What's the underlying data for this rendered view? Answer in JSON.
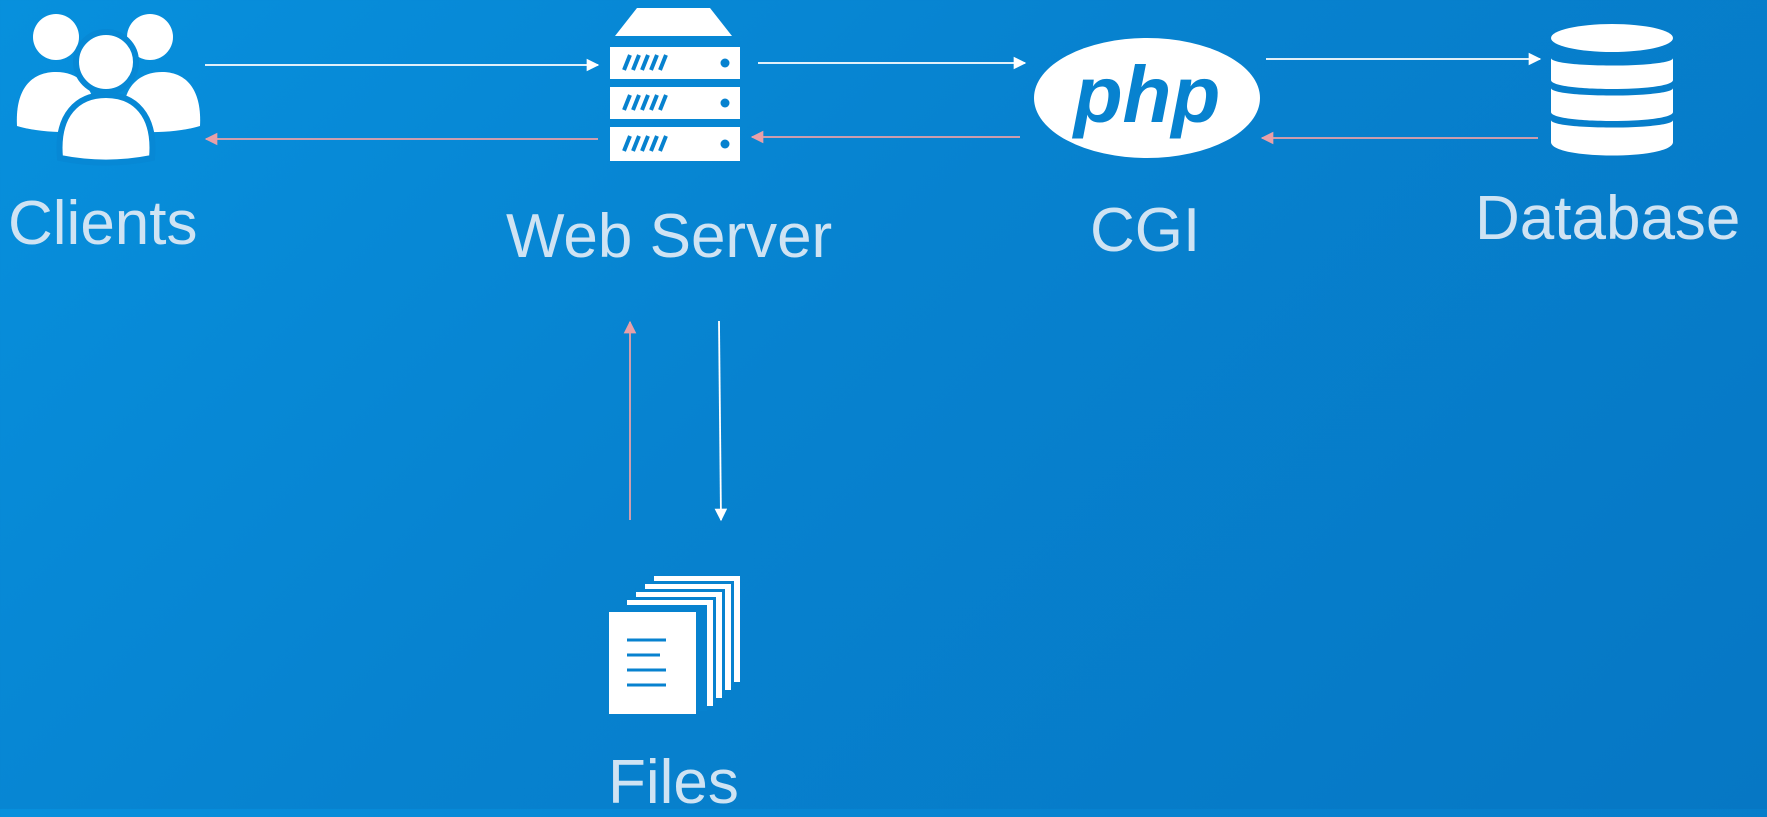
{
  "diagram": {
    "nodes": {
      "clients": {
        "label": "Clients",
        "icon": "users-group-icon"
      },
      "web_server": {
        "label": "Web Server",
        "icon": "server-rack-icon"
      },
      "cgi": {
        "label": "CGI",
        "icon": "php-logo-icon",
        "logo_text": "php"
      },
      "database": {
        "label": "Database",
        "icon": "database-icon"
      },
      "files": {
        "label": "Files",
        "icon": "documents-stack-icon"
      }
    },
    "edges": [
      {
        "from": "clients",
        "to": "web_server",
        "kind": "request"
      },
      {
        "from": "web_server",
        "to": "clients",
        "kind": "response"
      },
      {
        "from": "web_server",
        "to": "cgi",
        "kind": "request"
      },
      {
        "from": "cgi",
        "to": "web_server",
        "kind": "response"
      },
      {
        "from": "cgi",
        "to": "database",
        "kind": "request"
      },
      {
        "from": "database",
        "to": "cgi",
        "kind": "response"
      },
      {
        "from": "web_server",
        "to": "files",
        "kind": "request"
      },
      {
        "from": "files",
        "to": "web_server",
        "kind": "response"
      }
    ],
    "colors": {
      "background": "#0782cf",
      "icon": "#ffffff",
      "label": "#cfe3f3",
      "request_arrow": "#ffffff",
      "response_arrow": "#e8a0a8"
    }
  }
}
